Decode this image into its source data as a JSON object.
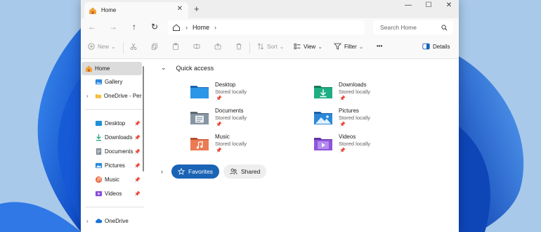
{
  "tab": {
    "title": "Home",
    "close": "✕",
    "new_tab": "+"
  },
  "window_controls": {
    "minimize": "—",
    "maximize": "☐",
    "close": "✕"
  },
  "nav": {
    "back": "←",
    "forward": "→",
    "up": "↑",
    "refresh": "↻"
  },
  "address": {
    "chevron": "›",
    "crumb": "Home",
    "trail_chevron": "›"
  },
  "search": {
    "placeholder": "Search Home"
  },
  "toolbar": {
    "new_label": "New",
    "sort_label": "Sort",
    "view_label": "View",
    "filter_label": "Filter",
    "more_label": "•••",
    "details_label": "Details",
    "dropdown": "⌄"
  },
  "sidebar": {
    "home": "Home",
    "gallery": "Gallery",
    "onedrive_personal": "OneDrive - Perso",
    "pinned": [
      "Desktop",
      "Downloads",
      "Documents",
      "Pictures",
      "Music",
      "Videos"
    ],
    "onedrive": "OneDrive",
    "pin_glyph": "📌",
    "chevron": "›"
  },
  "quick_access": {
    "heading": "Quick access",
    "chevron": "⌄",
    "folders": [
      {
        "name": "Desktop",
        "sub": "Stored locally",
        "icon": "desktop-folder",
        "color": "#1f8fd6"
      },
      {
        "name": "Downloads",
        "sub": "Stored locally",
        "icon": "downloads-folder",
        "color": "#1aa37a"
      },
      {
        "name": "Documents",
        "sub": "Stored locally",
        "icon": "documents-folder",
        "color": "#7b8894"
      },
      {
        "name": "Pictures",
        "sub": "Stored locally",
        "icon": "pictures-folder",
        "color": "#2b88d8"
      },
      {
        "name": "Music",
        "sub": "Stored locally",
        "icon": "music-folder",
        "color": "#e8734a"
      },
      {
        "name": "Videos",
        "sub": "Stored locally",
        "icon": "videos-folder",
        "color": "#8a4fd6"
      }
    ],
    "pin_glyph": "📌"
  },
  "tags": {
    "chevron": "›",
    "favorites": "Favorites",
    "shared": "Shared"
  },
  "colors": {
    "accent": "#1a63b5",
    "selection": "#dcdcdc",
    "wallpaper": "#a9c9ea"
  }
}
